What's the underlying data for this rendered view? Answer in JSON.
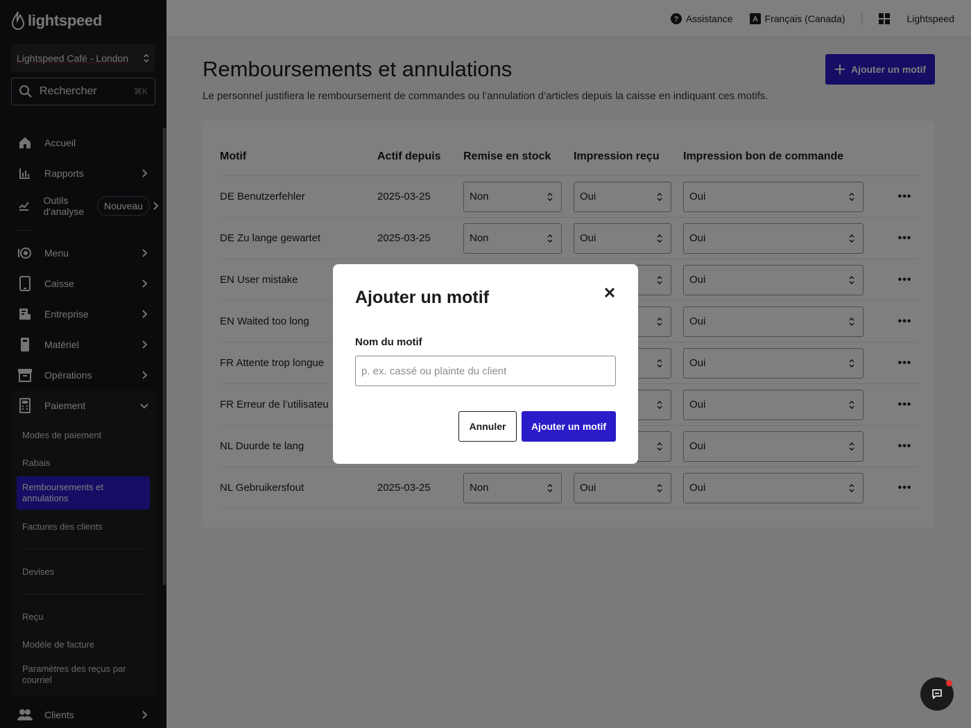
{
  "brand": {
    "logo_text": "lightspeed",
    "accent": "#2a1cc8"
  },
  "sidebar": {
    "store": "Lightspeed Café - London",
    "search": {
      "label": "Rechercher",
      "shortcut": "⌘K"
    },
    "items": [
      {
        "label": "Accueil",
        "icon": "home-icon"
      },
      {
        "label": "Rapports",
        "icon": "bar-chart-icon"
      },
      {
        "label": "Outils d'analyse",
        "icon": "analytics-icon",
        "badge": "Nouveau"
      },
      {
        "label": "Menu",
        "icon": "menu-icon"
      },
      {
        "label": "Caisse",
        "icon": "tablet-icon"
      },
      {
        "label": "Entreprise",
        "icon": "business-icon"
      },
      {
        "label": "Matériel",
        "icon": "hardware-icon"
      },
      {
        "label": "Opérations",
        "icon": "operations-icon"
      },
      {
        "label": "Paiement",
        "icon": "payment-icon"
      },
      {
        "label": "Clients",
        "icon": "clients-icon"
      }
    ],
    "payment_sub": [
      "Modes de paiement",
      "Rabais",
      "Remboursements et annulations",
      "Factures des clients",
      "Devises",
      "Reçu",
      "Modèle de facture",
      "Paramètres des reçus par courriel"
    ]
  },
  "topbar": {
    "help": "Assistance",
    "language": "Français (Canada)",
    "account": "Lightspeed"
  },
  "page": {
    "title": "Remboursements et annulations",
    "subtitle": "Le personnel justifiera le remboursement de commandes ou l’annulation d’articles depuis la caisse en indiquant ces motifs.",
    "add_button": "Ajouter un motif"
  },
  "table": {
    "headers": [
      "Motif",
      "Actif depuis",
      "Remise en stock",
      "Impression reçu",
      "Impression bon de commande"
    ],
    "rows": [
      {
        "motif": "DE Benutzerfehler",
        "since": "2025-03-25",
        "stock": "Non",
        "receipt": "Oui",
        "order": "Oui"
      },
      {
        "motif": "DE Zu lange gewartet",
        "since": "2025-03-25",
        "stock": "Non",
        "receipt": "Oui",
        "order": "Oui"
      },
      {
        "motif": "EN User mistake",
        "since": "",
        "stock": "",
        "receipt": "",
        "order": "Oui"
      },
      {
        "motif": "EN Waited too long",
        "since": "",
        "stock": "",
        "receipt": "",
        "order": "Oui"
      },
      {
        "motif": "FR Attente trop longue",
        "since": "",
        "stock": "",
        "receipt": "",
        "order": "Oui"
      },
      {
        "motif": "FR Erreur de l’utilisateu",
        "since": "",
        "stock": "",
        "receipt": "",
        "order": "Oui"
      },
      {
        "motif": "NL Duurde te lang",
        "since": "",
        "stock": "",
        "receipt": "",
        "order": "Oui"
      },
      {
        "motif": "NL Gebruikersfout",
        "since": "2025-03-25",
        "stock": "Non",
        "receipt": "Oui",
        "order": "Oui"
      }
    ]
  },
  "modal": {
    "title": "Ajouter un motif",
    "field_label": "Nom du motif",
    "field_placeholder": "p. ex. cassé ou plainte du client",
    "field_value": "",
    "cancel": "Annuler",
    "confirm": "Ajouter un motif"
  }
}
